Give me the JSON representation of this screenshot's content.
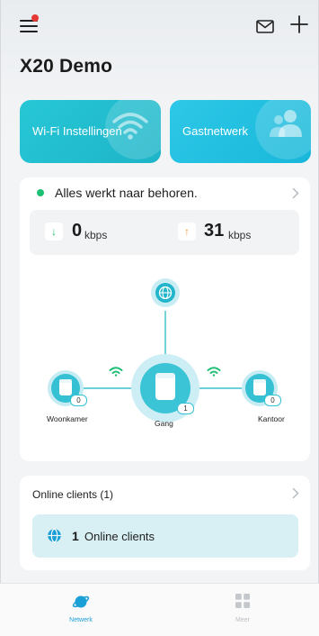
{
  "header": {
    "title": "X20 Demo"
  },
  "quick_cards": {
    "wifi_label": "Wi-Fi Instellingen",
    "guest_label": "Gastnetwerk"
  },
  "status": {
    "message": "Alles werkt naar behoren.",
    "color": "#1dbf73"
  },
  "speed": {
    "download_value": "0",
    "download_unit": "kbps",
    "upload_value": "31",
    "upload_unit": "kbps"
  },
  "topology": {
    "nodes": [
      {
        "name": "Woonkamer",
        "clients": "0"
      },
      {
        "name": "Gang",
        "clients": "1"
      },
      {
        "name": "Kantoor",
        "clients": "0"
      }
    ]
  },
  "clients": {
    "section_title": "Online clients (1)",
    "count": "1",
    "label": "Online clients"
  },
  "tabbar": {
    "tabs": [
      {
        "label": "Netwerk",
        "active": true,
        "color": "#1a9fd6"
      },
      {
        "label": "Meer",
        "active": false,
        "color": "#b9bec4"
      }
    ]
  },
  "colors": {
    "accent": "#1db4c8",
    "accent_light": "#d8eff3"
  }
}
